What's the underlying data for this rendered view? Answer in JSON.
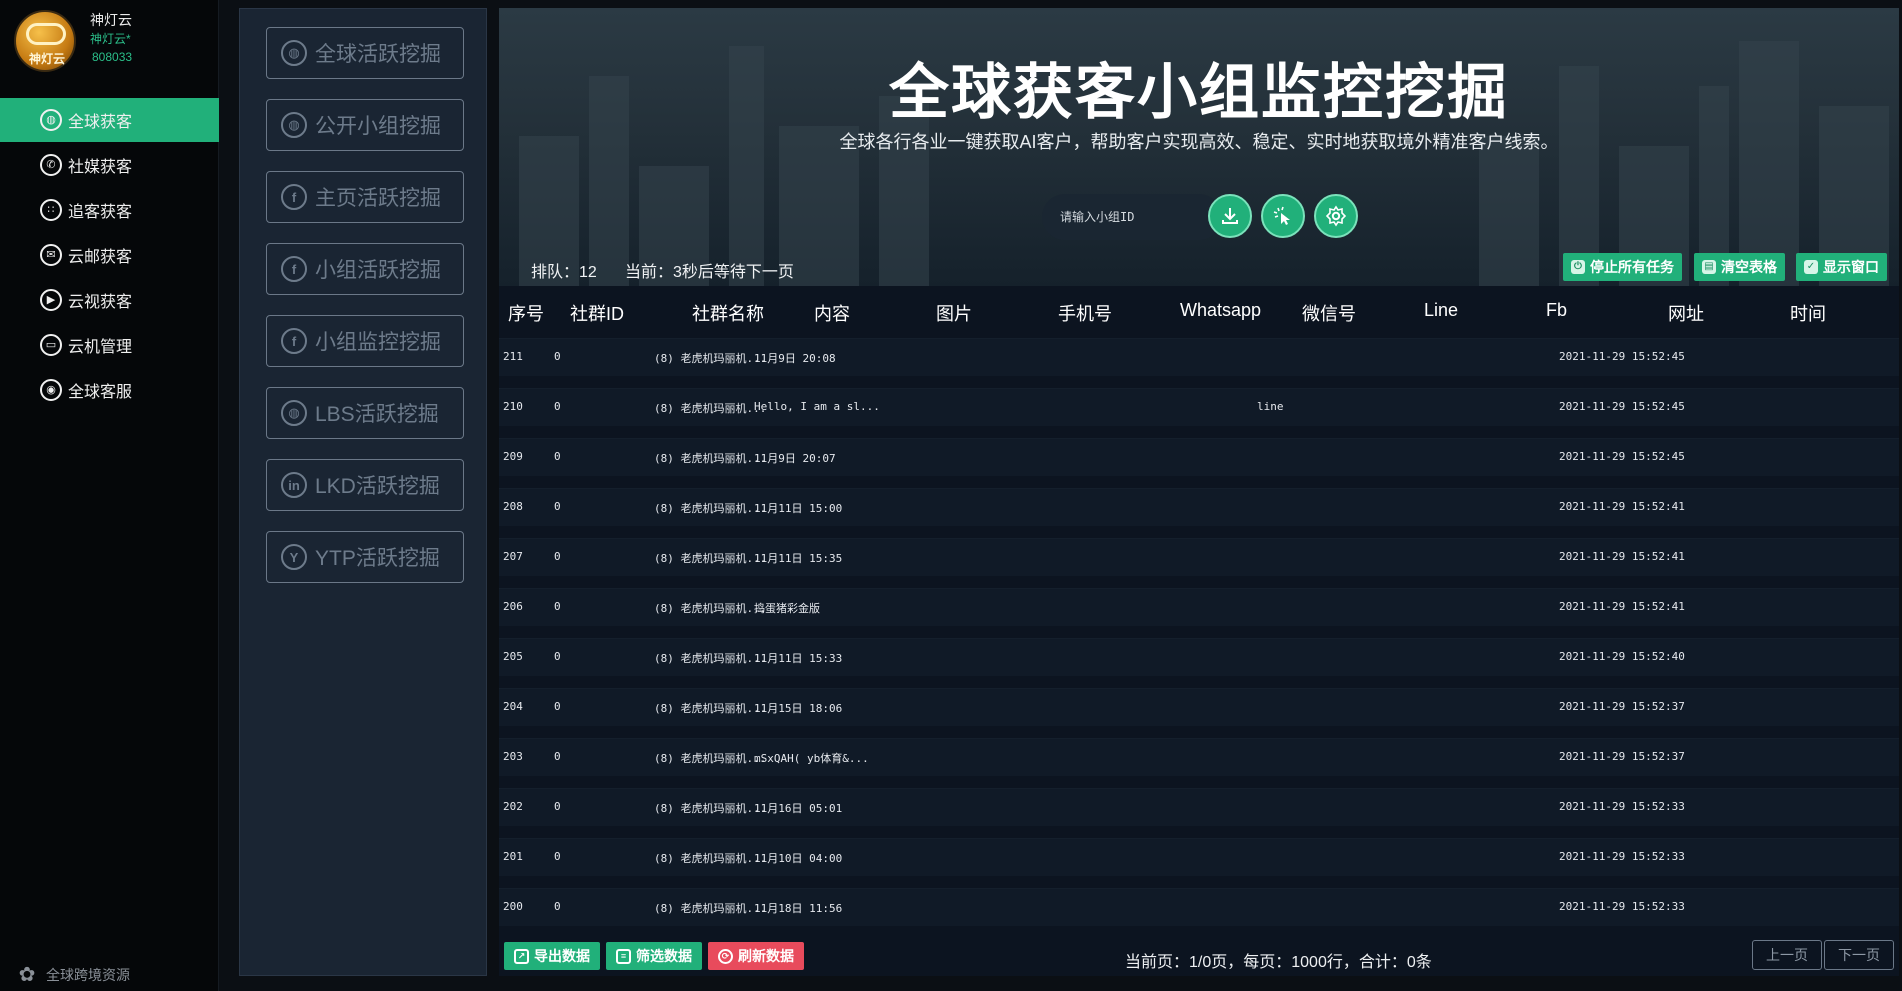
{
  "brand": {
    "logo_text": "神灯云",
    "name": "神灯云",
    "subtitle": "神灯云*",
    "id": "808033"
  },
  "nav": [
    {
      "label": "全球获客",
      "icon": "globe-icon",
      "active": true
    },
    {
      "label": "社媒获客",
      "icon": "whatsapp-icon",
      "active": false
    },
    {
      "label": "追客获客",
      "icon": "grid-icon",
      "active": false
    },
    {
      "label": "云邮获客",
      "icon": "mail-icon",
      "active": false
    },
    {
      "label": "云视获客",
      "icon": "play-icon",
      "active": false
    },
    {
      "label": "云机管理",
      "icon": "phone-icon",
      "active": false
    },
    {
      "label": "全球客服",
      "icon": "chat-icon",
      "active": false
    }
  ],
  "footer_label": "全球跨境资源",
  "modes": [
    {
      "label": "全球活跃挖掘",
      "icon": "globe-icon"
    },
    {
      "label": "公开小组挖掘",
      "icon": "globe-icon"
    },
    {
      "label": "主页活跃挖掘",
      "icon": "facebook-icon"
    },
    {
      "label": "小组活跃挖掘",
      "icon": "facebook-icon"
    },
    {
      "label": "小组监控挖掘",
      "icon": "facebook-icon"
    },
    {
      "label": "LBS活跃挖掘",
      "icon": "globe-icon"
    },
    {
      "label": "LKD活跃挖掘",
      "icon": "linkedin-icon"
    },
    {
      "label": "YTP活跃挖掘",
      "icon": "youtube-icon"
    }
  ],
  "hero": {
    "title": "全球获客小组监控挖掘",
    "subtitle": "全球各行各业一键获取AI客户，帮助客户实现高效、稳定、实时地获取境外精准客户线索。",
    "search_placeholder": "请输入小组ID"
  },
  "status": {
    "queue": "排队：12",
    "current": "当前：3秒后等待下一页"
  },
  "top_buttons": {
    "stop": "停止所有任务",
    "clear": "清空表格",
    "show": "显示窗口"
  },
  "columns": [
    "序号",
    "社群ID",
    "社群名称",
    "内容",
    "图片",
    "手机号",
    "Whatsapp",
    "微信号",
    "Line",
    "Fb",
    "网址",
    "时间"
  ],
  "rows": [
    {
      "no": "211",
      "gid": "0",
      "name": "(8) 老虎机玛丽机...",
      "content": "11月9日 20:08",
      "line": "",
      "time": "2021-11-29 15:52:45"
    },
    {
      "no": "210",
      "gid": "0",
      "name": "(8) 老虎机玛丽机...",
      "content": "Hello, I am a sl...",
      "line": "line",
      "time": "2021-11-29 15:52:45"
    },
    {
      "no": "209",
      "gid": "0",
      "name": "(8) 老虎机玛丽机...",
      "content": "11月9日 20:07",
      "line": "",
      "time": "2021-11-29 15:52:45"
    },
    {
      "no": "208",
      "gid": "0",
      "name": "(8) 老虎机玛丽机...",
      "content": "11月11日 15:00",
      "line": "",
      "time": "2021-11-29 15:52:41"
    },
    {
      "no": "207",
      "gid": "0",
      "name": "(8) 老虎机玛丽机...",
      "content": "11月11日 15:35",
      "line": "",
      "time": "2021-11-29 15:52:41"
    },
    {
      "no": "206",
      "gid": "0",
      "name": "(8) 老虎机玛丽机...",
      "content": "捣蛋猪彩金版",
      "line": "",
      "time": "2021-11-29 15:52:41"
    },
    {
      "no": "205",
      "gid": "0",
      "name": "(8) 老虎机玛丽机...",
      "content": "11月11日 15:33",
      "line": "",
      "time": "2021-11-29 15:52:40"
    },
    {
      "no": "204",
      "gid": "0",
      "name": "(8) 老虎机玛丽机...",
      "content": "11月15日 18:06",
      "line": "",
      "time": "2021-11-29 15:52:37"
    },
    {
      "no": "203",
      "gid": "0",
      "name": "(8) 老虎机玛丽机...",
      "content": "mSxQAH( yb体育&...",
      "line": "",
      "time": "2021-11-29 15:52:37"
    },
    {
      "no": "202",
      "gid": "0",
      "name": "(8) 老虎机玛丽机...",
      "content": "11月16日 05:01",
      "line": "",
      "time": "2021-11-29 15:52:33"
    },
    {
      "no": "201",
      "gid": "0",
      "name": "(8) 老虎机玛丽机...",
      "content": "11月10日 04:00",
      "line": "",
      "time": "2021-11-29 15:52:33"
    },
    {
      "no": "200",
      "gid": "0",
      "name": "(8) 老虎机玛丽机...",
      "content": "11月18日 11:56",
      "line": "",
      "time": "2021-11-29 15:52:33"
    }
  ],
  "bottom": {
    "export": "导出数据",
    "filter": "筛选数据",
    "refresh": "刷新数据",
    "page_info": "当前页：1/0页，每页：1000行，合计：0条",
    "prev": "上一页",
    "next": "下一页"
  },
  "colors": {
    "accent": "#21b07a",
    "danger": "#e84b5c",
    "panel": "#1a2533",
    "background": "#0c1420"
  }
}
